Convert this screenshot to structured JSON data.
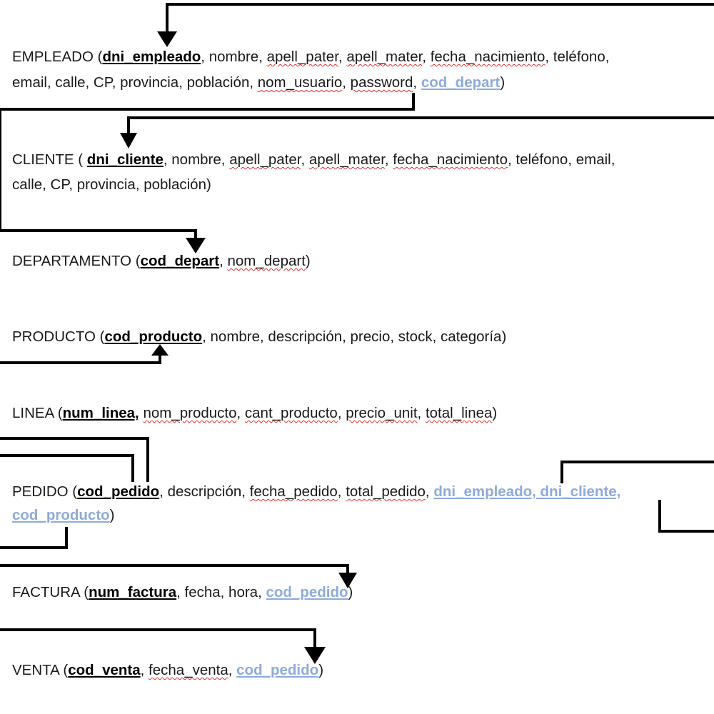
{
  "entities": [
    {
      "id": "empleado",
      "lines": [
        [
          {
            "t": "EMPLEADO (",
            "k": "txt"
          },
          {
            "t": "dni_empleado",
            "k": "pk"
          },
          {
            "t": ", nombre, ",
            "k": "txt"
          },
          {
            "t": "apell_pater",
            "k": "sq"
          },
          {
            "t": ", ",
            "k": "txt"
          },
          {
            "t": "apell_mater",
            "k": "sq"
          },
          {
            "t": ", ",
            "k": "txt"
          },
          {
            "t": "fecha_nacimiento",
            "k": "sq"
          },
          {
            "t": ", teléfono,",
            "k": "txt"
          }
        ],
        [
          {
            "t": "email, calle, CP, provincia, población, ",
            "k": "txt"
          },
          {
            "t": "nom_usuario",
            "k": "sq"
          },
          {
            "t": ", ",
            "k": "txt"
          },
          {
            "t": "password",
            "k": "sq"
          },
          {
            "t": ", ",
            "k": "txt"
          },
          {
            "t": "cod_depart",
            "k": "fk"
          },
          {
            "t": ")",
            "k": "txt"
          }
        ]
      ]
    },
    {
      "id": "cliente",
      "lines": [
        [
          {
            "t": "CLIENTE ( ",
            "k": "txt"
          },
          {
            "t": "dni_cliente",
            "k": "pk"
          },
          {
            "t": ", nombre, ",
            "k": "txt"
          },
          {
            "t": "apell_pater",
            "k": "sq"
          },
          {
            "t": ", ",
            "k": "txt"
          },
          {
            "t": "apell_mater",
            "k": "sq"
          },
          {
            "t": ", ",
            "k": "txt"
          },
          {
            "t": "fecha_nacimiento",
            "k": "sq"
          },
          {
            "t": ", teléfono, email,",
            "k": "txt"
          }
        ],
        [
          {
            "t": "calle, CP, provincia, población)",
            "k": "txt"
          }
        ]
      ]
    },
    {
      "id": "departamento",
      "lines": [
        [
          {
            "t": "DEPARTAMENTO (",
            "k": "txt"
          },
          {
            "t": "cod_depart",
            "k": "pk"
          },
          {
            "t": ", ",
            "k": "txt"
          },
          {
            "t": "nom_depart",
            "k": "sq"
          },
          {
            "t": ")",
            "k": "txt"
          }
        ]
      ]
    },
    {
      "id": "producto",
      "lines": [
        [
          {
            "t": "PRODUCTO (",
            "k": "txt"
          },
          {
            "t": "cod_producto",
            "k": "pk"
          },
          {
            "t": ", nombre, descripción, precio, stock, categoría)",
            "k": "txt"
          }
        ]
      ]
    },
    {
      "id": "linea",
      "lines": [
        [
          {
            "t": "LINEA (",
            "k": "txt"
          },
          {
            "t": "num_linea,",
            "k": "pk"
          },
          {
            "t": " ",
            "k": "txt"
          },
          {
            "t": "nom_producto",
            "k": "sq"
          },
          {
            "t": ", ",
            "k": "txt"
          },
          {
            "t": "cant_producto",
            "k": "sq"
          },
          {
            "t": ", ",
            "k": "txt"
          },
          {
            "t": "precio_unit",
            "k": "sq"
          },
          {
            "t": ", ",
            "k": "txt"
          },
          {
            "t": "total_linea",
            "k": "sq"
          },
          {
            "t": ")",
            "k": "txt"
          }
        ]
      ]
    },
    {
      "id": "pedido",
      "lines": [
        [
          {
            "t": "PEDIDO (",
            "k": "txt"
          },
          {
            "t": "cod_pedido",
            "k": "pk"
          },
          {
            "t": ", descripción, ",
            "k": "txt"
          },
          {
            "t": "fecha_pedido",
            "k": "sq"
          },
          {
            "t": ", ",
            "k": "txt"
          },
          {
            "t": "total_pedido",
            "k": "sq"
          },
          {
            "t": ", ",
            "k": "txt"
          },
          {
            "t": "dni_empleado, dni_cliente,",
            "k": "fk"
          }
        ],
        [
          {
            "t": "cod_producto",
            "k": "fk"
          },
          {
            "t": ")",
            "k": "txt"
          }
        ]
      ]
    },
    {
      "id": "factura",
      "lines": [
        [
          {
            "t": "FACTURA (",
            "k": "txt"
          },
          {
            "t": "num_factura",
            "k": "pk"
          },
          {
            "t": ", fecha, hora, ",
            "k": "txt"
          },
          {
            "t": "cod_pedido",
            "k": "fk"
          },
          {
            "t": ")",
            "k": "txt"
          }
        ]
      ]
    },
    {
      "id": "venta",
      "lines": [
        [
          {
            "t": "VENTA (",
            "k": "txt"
          },
          {
            "t": "cod_venta",
            "k": "pk"
          },
          {
            "t": ", ",
            "k": "txt"
          },
          {
            "t": "fecha_venta",
            "k": "sq"
          },
          {
            "t": ", ",
            "k": "txt"
          },
          {
            "t": "cod_pedido",
            "k": "fk"
          },
          {
            "t": ")",
            "k": "txt"
          }
        ]
      ]
    }
  ],
  "colors": {
    "foreign_key": "#8eaadb",
    "spellcheck_underline": "#e03030",
    "arrow": "#000000"
  }
}
